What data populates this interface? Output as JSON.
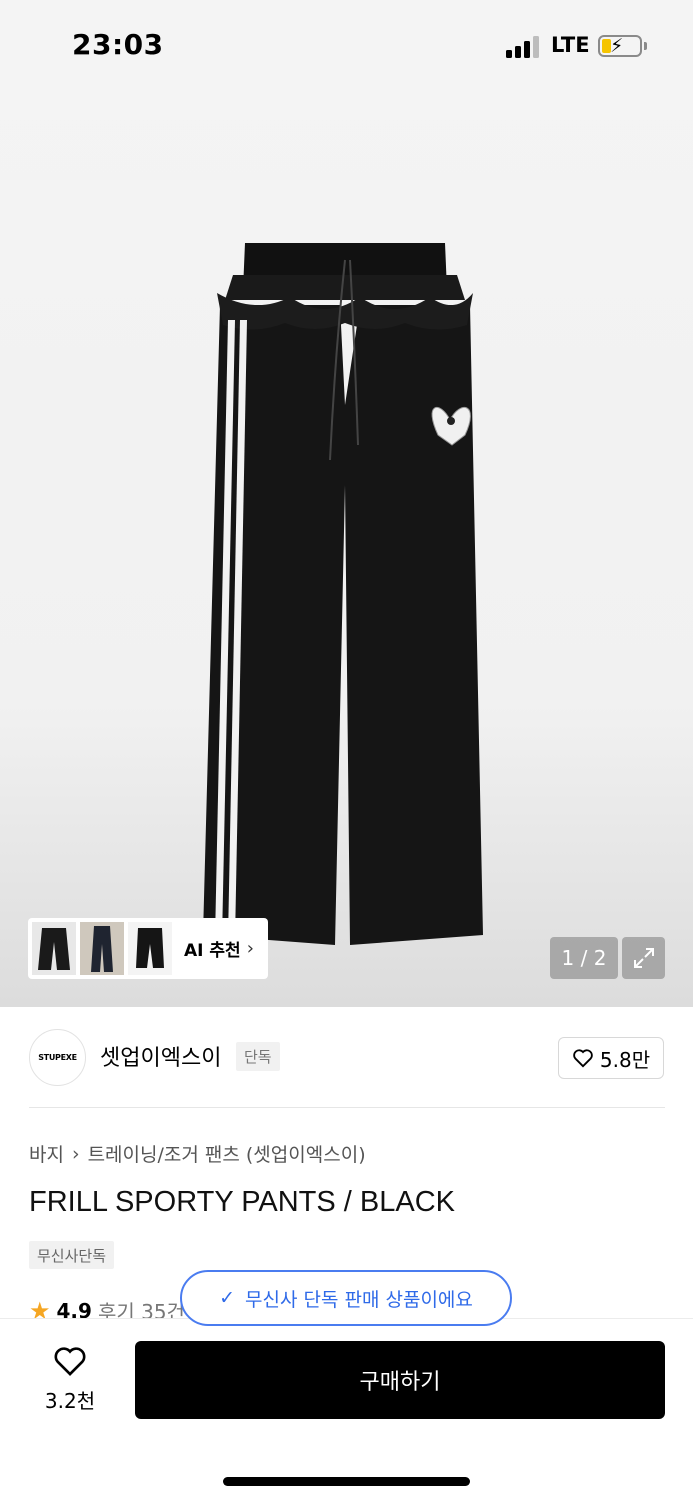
{
  "status_bar": {
    "time": "23:03",
    "network": "LTE",
    "battery_state": "charging",
    "icons": [
      "signal-icon",
      "battery-charging-icon"
    ]
  },
  "gallery": {
    "ai_recommend_label": "AI 추천",
    "page_indicator": "1 / 2",
    "icons": [
      "chevron-right-icon",
      "expand-icon"
    ]
  },
  "brand": {
    "logo_text": "STUPEXE",
    "name": "셋업이엑스이",
    "badge": "단독",
    "like_count": "5.8만"
  },
  "product": {
    "breadcrumb": [
      "바지",
      "트레이닝/조거 팬츠 (셋업이엑스이)"
    ],
    "title": "FRILL SPORTY PANTS / BLACK",
    "tag": "무신사단독",
    "rating": "4.9",
    "reviews": "후기 35건"
  },
  "toast": {
    "message": "무신사 단독 판매 상품이에요"
  },
  "bottom_bar": {
    "wish_count": "3.2천",
    "buy_label": "구매하기"
  },
  "colors": {
    "accent_blue": "#2f6ae8",
    "star": "#f5a623",
    "buy_button": "#000000",
    "battery": "#f5c400"
  }
}
